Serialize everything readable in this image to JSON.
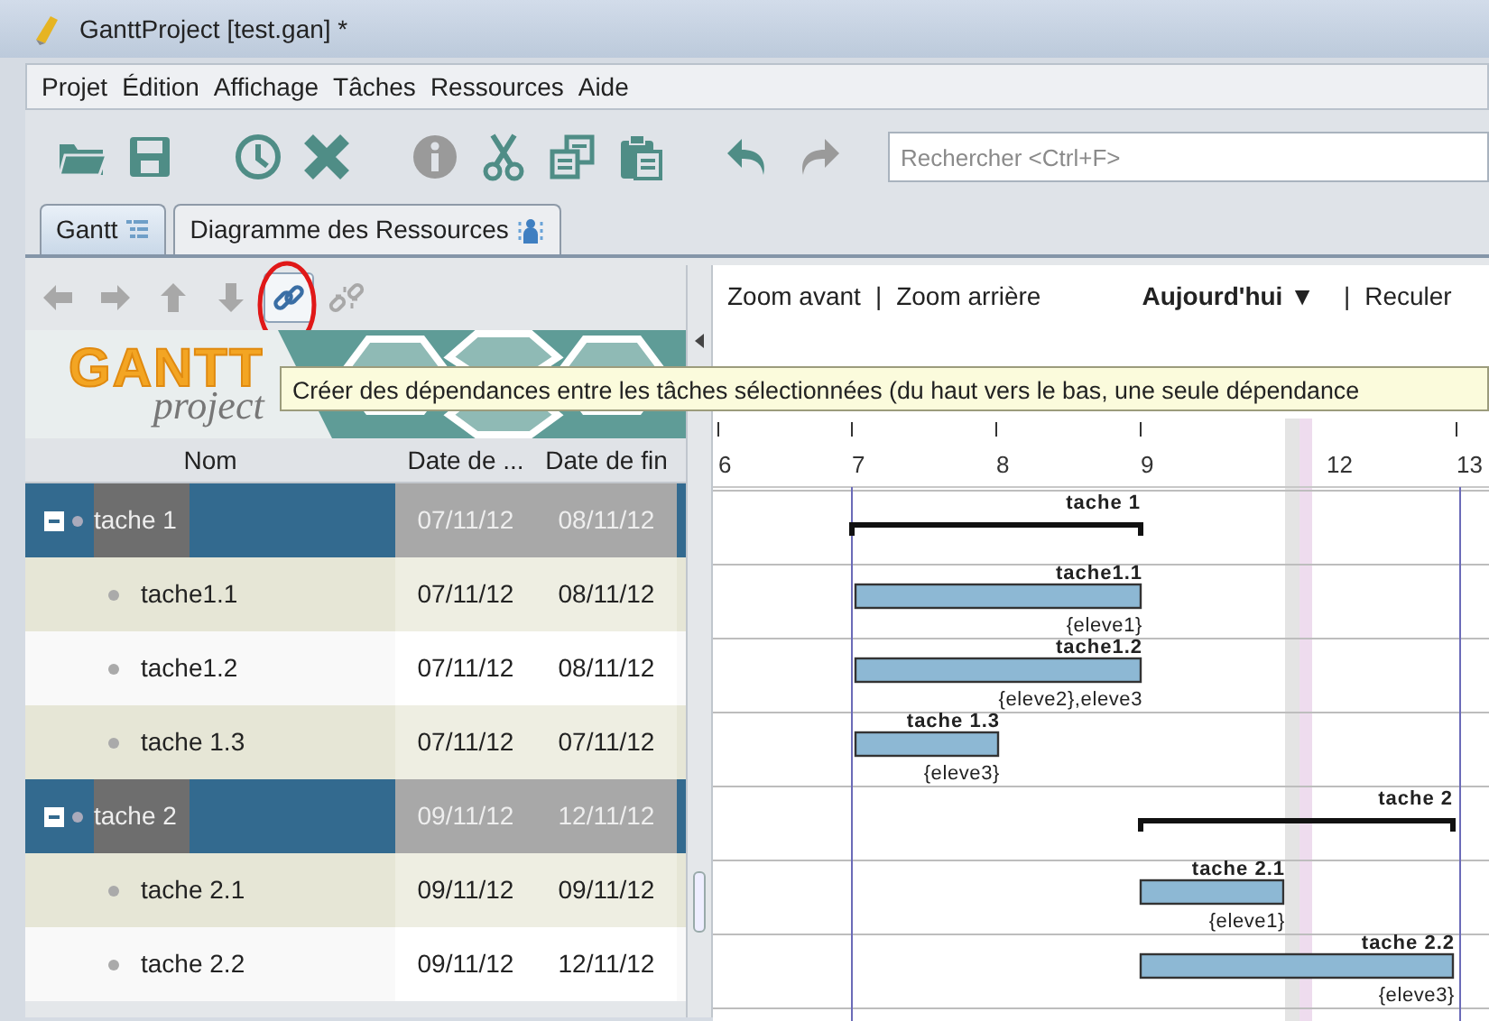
{
  "window": {
    "title": "GanttProject [test.gan] *"
  },
  "menu": [
    {
      "label": "Projet"
    },
    {
      "label": "Édition"
    },
    {
      "label": "Affichage"
    },
    {
      "label": "Tâches"
    },
    {
      "label": "Ressources"
    },
    {
      "label": "Aide"
    }
  ],
  "toolbar": {
    "buttons": [
      {
        "kind": "open",
        "disabled": false
      },
      {
        "kind": "save",
        "disabled": false
      },
      {
        "kind": "gap"
      },
      {
        "kind": "clock",
        "disabled": false
      },
      {
        "kind": "delete",
        "disabled": false
      },
      {
        "kind": "gap"
      },
      {
        "kind": "info",
        "disabled": true
      },
      {
        "kind": "cut",
        "disabled": false
      },
      {
        "kind": "copy",
        "disabled": false
      },
      {
        "kind": "paste",
        "disabled": false
      },
      {
        "kind": "gap"
      },
      {
        "kind": "undo",
        "disabled": false
      },
      {
        "kind": "redo",
        "disabled": true
      }
    ],
    "search": {
      "placeholder": "Rechercher <Ctrl+F>"
    }
  },
  "tabs": [
    {
      "label": "Gantt",
      "kind": "gantt",
      "selected": true
    },
    {
      "label": "Diagramme des Ressources",
      "kind": "resources",
      "selected": false
    }
  ],
  "task_toolbar": {
    "buttons": [
      {
        "kind": "left",
        "disabled": true,
        "highlighted": false
      },
      {
        "kind": "right",
        "disabled": true,
        "highlighted": false
      },
      {
        "kind": "up",
        "disabled": true,
        "highlighted": false
      },
      {
        "kind": "down",
        "disabled": true,
        "highlighted": false
      },
      {
        "kind": "link",
        "disabled": false,
        "highlighted": true
      },
      {
        "kind": "unlink",
        "disabled": true,
        "highlighted": false
      }
    ],
    "tooltip": "Créer des dépendances entre les tâches sélectionnées (du haut vers le bas, une seule dépendance"
  },
  "logo": {
    "brand": "GANTT",
    "sub": "project"
  },
  "table": {
    "columns": [
      "Nom",
      "Date de ...",
      "Date de fin"
    ],
    "rows": [
      {
        "kind": "group",
        "name": "tache 1",
        "start": "07/11/12",
        "end": "08/11/12",
        "expanded": true,
        "selected": true
      },
      {
        "kind": "task",
        "name": "tache1.1",
        "start": "07/11/12",
        "end": "08/11/12",
        "selected": false
      },
      {
        "kind": "task",
        "name": "tache1.2",
        "start": "07/11/12",
        "end": "08/11/12",
        "selected": false
      },
      {
        "kind": "task",
        "name": "tache 1.3",
        "start": "07/11/12",
        "end": "07/11/12",
        "selected": false
      },
      {
        "kind": "group",
        "name": "tache 2",
        "start": "09/11/12",
        "end": "12/11/12",
        "expanded": true,
        "selected": true
      },
      {
        "kind": "task",
        "name": "tache 2.1",
        "start": "09/11/12",
        "end": "09/11/12",
        "selected": false
      },
      {
        "kind": "task",
        "name": "tache 2.2",
        "start": "09/11/12",
        "end": "12/11/12",
        "selected": false
      }
    ]
  },
  "timeline": {
    "zoom_in": "Zoom avant",
    "separator": "|",
    "zoom_out": "Zoom arrière",
    "today": "Aujourd'hui",
    "today_caret": "▼",
    "separator_2": "|",
    "back": "Reculer",
    "ticks": [
      "6",
      "7",
      "8",
      "9",
      "12",
      "13"
    ],
    "bars": [
      {
        "kind": "summary",
        "label": "tache 1"
      },
      {
        "kind": "task",
        "label": "tache1.1",
        "resources": "{eleve1}"
      },
      {
        "kind": "task",
        "label": "tache1.2",
        "resources": "{eleve2},eleve3"
      },
      {
        "kind": "task",
        "label": "tache 1.3",
        "resources": "{eleve3}"
      },
      {
        "kind": "summary",
        "label": "tache 2"
      },
      {
        "kind": "task",
        "label": "tache 2.1",
        "resources": "{eleve1}"
      },
      {
        "kind": "task",
        "label": "tache 2.2",
        "resources": "{eleve3}"
      }
    ]
  }
}
